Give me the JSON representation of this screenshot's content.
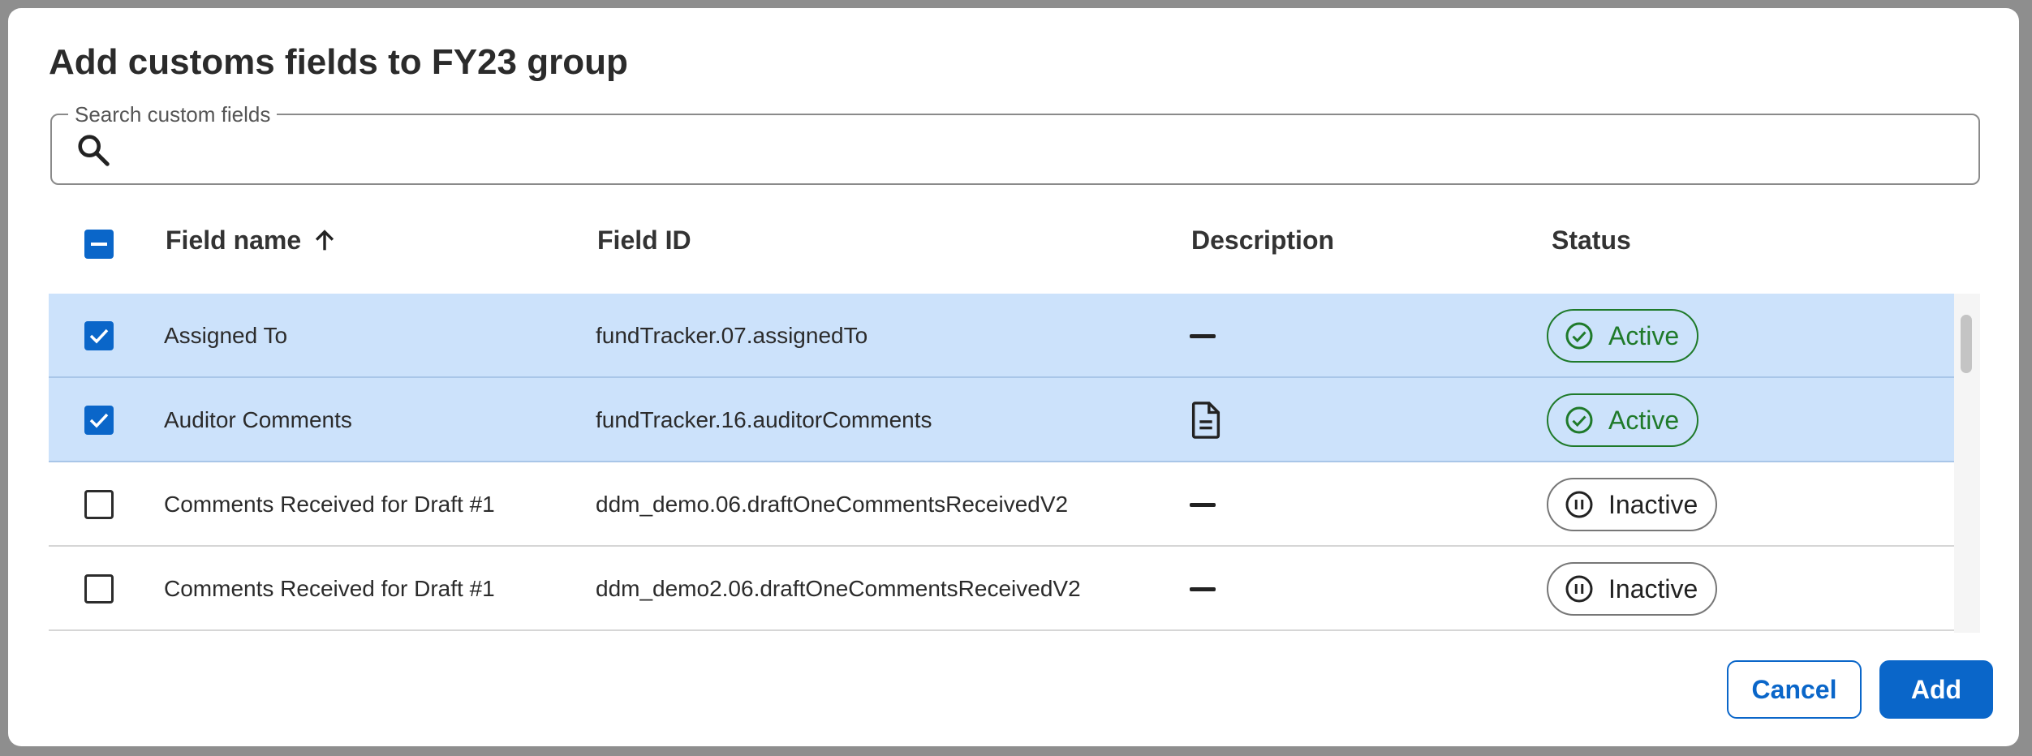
{
  "dialog": {
    "title": "Add customs fields to FY23 group"
  },
  "search": {
    "label": "Search custom fields",
    "value": "",
    "icon": "search-icon"
  },
  "table": {
    "columns": {
      "field_name": "Field name",
      "field_id": "Field ID",
      "description": "Description",
      "status": "Status"
    },
    "sort": {
      "column": "field_name",
      "direction": "ascending",
      "icon": "arrow-up-icon"
    },
    "select_all_state": "indeterminate",
    "rows": [
      {
        "selected": true,
        "name": "Assigned To",
        "field_id": "fundTracker.07.assignedTo",
        "description": "dash-icon",
        "status": "Active"
      },
      {
        "selected": true,
        "name": "Auditor Comments",
        "field_id": "fundTracker.16.auditorComments",
        "description": "document-icon",
        "status": "Active"
      },
      {
        "selected": false,
        "name": "Comments Received for Draft #1",
        "field_id": "ddm_demo.06.draftOneCommentsReceivedV2",
        "description": "dash-icon",
        "status": "Inactive"
      },
      {
        "selected": false,
        "name": "Comments Received for Draft #1",
        "field_id": "ddm_demo2.06.draftOneCommentsReceivedV2",
        "description": "dash-icon",
        "status": "Inactive"
      }
    ]
  },
  "actions": {
    "cancel_label": "Cancel",
    "add_label": "Add"
  },
  "colors": {
    "accent": "#0a66c9",
    "selected_row": "#cce2fb",
    "active_status": "#1f7a2a",
    "backdrop": "#8e8e8e"
  }
}
